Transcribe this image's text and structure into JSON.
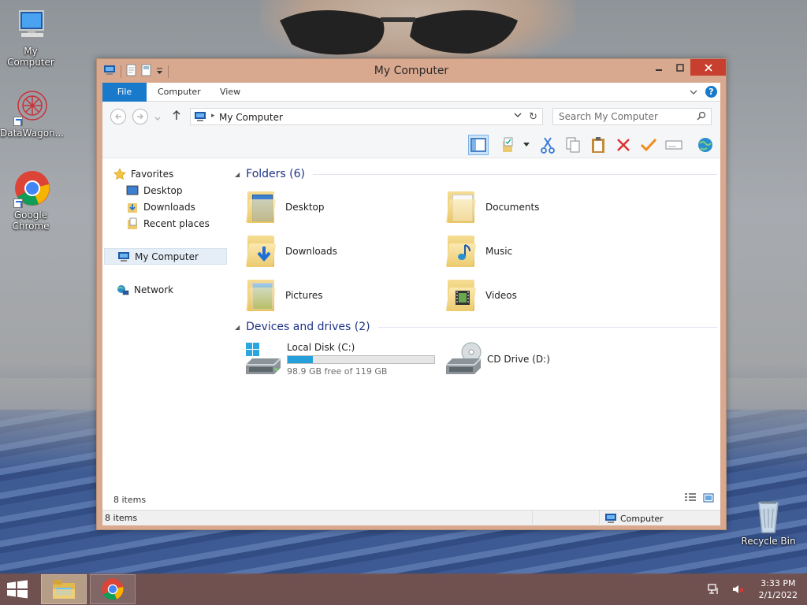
{
  "desktop": {
    "icons": [
      {
        "label": "My Computer"
      },
      {
        "label": "DataWagon..."
      },
      {
        "label": "Google Chrome"
      },
      {
        "label": "Recycle Bin"
      }
    ]
  },
  "window": {
    "title": "My Computer",
    "ribbon_tabs": [
      "File",
      "Computer",
      "View"
    ],
    "address": "My Computer",
    "search_placeholder": "Search My Computer",
    "nav": {
      "favorites": "Favorites",
      "favorites_items": [
        "Desktop",
        "Downloads",
        "Recent places"
      ],
      "this_pc": "My Computer",
      "network": "Network"
    },
    "groups": {
      "folders_title": "Folders (6)",
      "folders": [
        "Desktop",
        "Documents",
        "Downloads",
        "Music",
        "Pictures",
        "Videos"
      ],
      "drives_title": "Devices and drives (2)",
      "drives": [
        {
          "name": "Local Disk (C:)",
          "free": "98.9 GB free of 119 GB",
          "used_fraction": 0.17
        },
        {
          "name": "CD Drive (D:)"
        }
      ]
    },
    "status_count": "8 items",
    "statusbar_left": "8 items",
    "statusbar_right": "Computer"
  },
  "taskbar": {
    "time": "3:33 PM",
    "date": "2/1/2022"
  },
  "colors": {
    "accent": "#1979ca",
    "title_bg": "#d8a88f",
    "close": "#c7402f",
    "drive_bar": "#26a0da"
  }
}
